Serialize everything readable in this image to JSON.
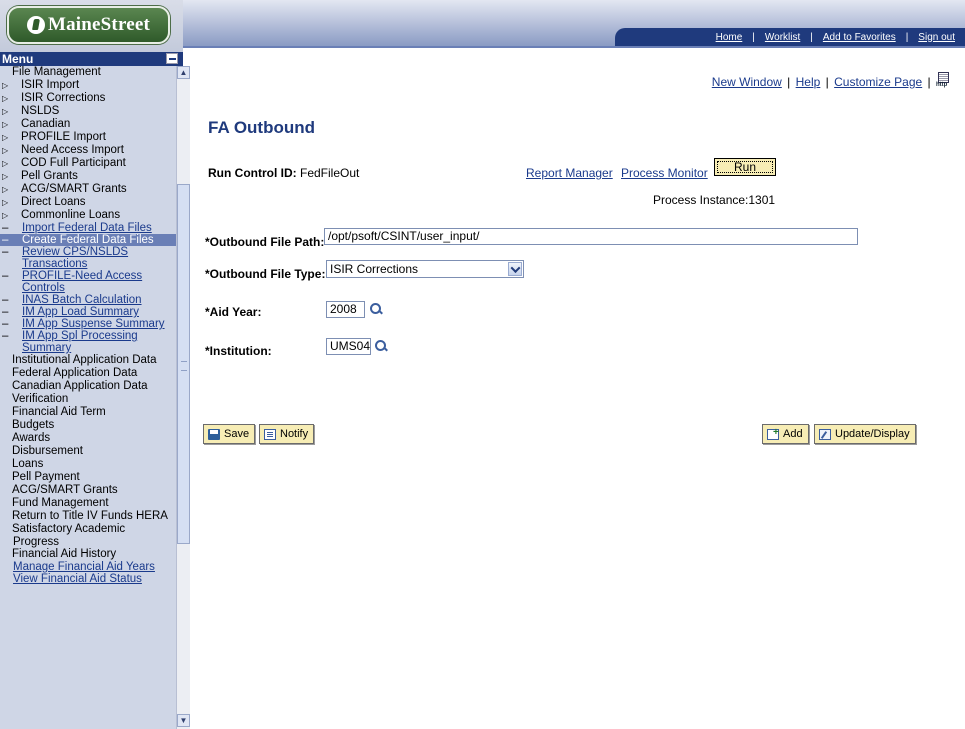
{
  "brand": {
    "name": "MaineStreet"
  },
  "header_nav": [
    {
      "label": "Home"
    },
    {
      "label": "Worklist"
    },
    {
      "label": "Add to Favorites"
    },
    {
      "label": "Sign out"
    }
  ],
  "menu": {
    "title": "Menu",
    "items": [
      {
        "label": "File Management",
        "level": 0,
        "type": "open"
      },
      {
        "label": "ISIR Import",
        "level": 1,
        "type": "folder"
      },
      {
        "label": "ISIR Corrections",
        "level": 1,
        "type": "folder"
      },
      {
        "label": "NSLDS",
        "level": 1,
        "type": "folder"
      },
      {
        "label": "Canadian",
        "level": 1,
        "type": "folder"
      },
      {
        "label": "PROFILE Import",
        "level": 1,
        "type": "folder"
      },
      {
        "label": "Need Access Import",
        "level": 1,
        "type": "folder"
      },
      {
        "label": "COD Full Participant",
        "level": 1,
        "type": "folder"
      },
      {
        "label": "Pell Grants",
        "level": 1,
        "type": "folder"
      },
      {
        "label": "ACG/SMART Grants",
        "level": 1,
        "type": "folder"
      },
      {
        "label": "Direct Loans",
        "level": 1,
        "type": "folder"
      },
      {
        "label": "Commonline Loans",
        "level": 1,
        "type": "folder"
      },
      {
        "label": "Import Federal Data Files",
        "level": 1,
        "type": "link"
      },
      {
        "label": "Create Federal Data Files",
        "level": 1,
        "type": "link",
        "selected": true
      },
      {
        "label": "Review CPS/NSLDS Transactions",
        "level": 1,
        "type": "link"
      },
      {
        "label": "PROFILE-Need Access Controls",
        "level": 1,
        "type": "link"
      },
      {
        "label": "INAS Batch Calculation",
        "level": 1,
        "type": "link"
      },
      {
        "label": "IM App Load Summary",
        "level": 1,
        "type": "link"
      },
      {
        "label": "IM App Suspense Summary",
        "level": 1,
        "type": "link"
      },
      {
        "label": "IM App Spl Processing Summary",
        "level": 1,
        "type": "link"
      },
      {
        "label": "Institutional Application Data",
        "level": 0,
        "type": "folder"
      },
      {
        "label": "Federal Application Data",
        "level": 0,
        "type": "folder"
      },
      {
        "label": "Canadian Application Data",
        "level": 0,
        "type": "folder"
      },
      {
        "label": "Verification",
        "level": 0,
        "type": "folder"
      },
      {
        "label": "Financial Aid Term",
        "level": 0,
        "type": "folder"
      },
      {
        "label": "Budgets",
        "level": 0,
        "type": "folder"
      },
      {
        "label": "Awards",
        "level": 0,
        "type": "folder"
      },
      {
        "label": "Disbursement",
        "level": 0,
        "type": "folder"
      },
      {
        "label": "Loans",
        "level": 0,
        "type": "folder"
      },
      {
        "label": "Pell Payment",
        "level": 0,
        "type": "folder"
      },
      {
        "label": "ACG/SMART Grants",
        "level": 0,
        "type": "folder"
      },
      {
        "label": "Fund Management",
        "level": 0,
        "type": "folder"
      },
      {
        "label": "Return to Title IV Funds HERA",
        "level": 0,
        "type": "folder"
      },
      {
        "label": "Satisfactory Academic Progress",
        "level": 0,
        "type": "folder"
      },
      {
        "label": "Financial Aid History",
        "level": 0,
        "type": "folder"
      },
      {
        "label": "Manage Financial Aid Years",
        "level": 0,
        "type": "link"
      },
      {
        "label": "View Financial Aid Status",
        "level": 0,
        "type": "link"
      }
    ]
  },
  "page_links": {
    "new_window": "New Window",
    "help": "Help",
    "customize": "Customize Page",
    "separator": "|"
  },
  "page": {
    "title": "FA Outbound",
    "run_control_label": "Run Control ID:",
    "run_control_value": "FedFileOut",
    "report_manager": "Report Manager",
    "process_monitor": "Process Monitor",
    "run_button": "Run",
    "process_instance": "Process Instance:1301",
    "fields": {
      "file_path_label": "*Outbound File Path:",
      "file_path_value": "/opt/psoft/CSINT/user_input/",
      "file_type_label": "*Outbound File Type:",
      "file_type_value": "ISIR Corrections",
      "aid_year_label": "*Aid Year:",
      "aid_year_value": "2008",
      "institution_label": "*Institution:",
      "institution_value": "UMS04"
    },
    "buttons": {
      "save": "Save",
      "notify": "Notify",
      "add": "Add",
      "update_display": "Update/Display"
    }
  },
  "icons": {
    "logo": "maine-logo-icon",
    "lookup": "magnifier-icon",
    "http_link": "http-link-icon"
  }
}
